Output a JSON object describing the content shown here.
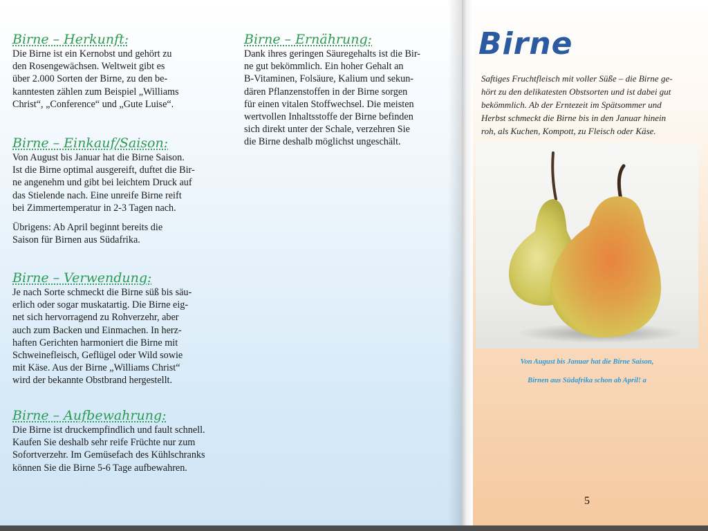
{
  "left": {
    "herkunft": {
      "heading": "Birne – Herkunft:",
      "text": "Die Birne ist ein Kernobst und gehört zu\nden Rosengewächsen. Weltweit gibt es\nüber 2.000 Sorten der Birne, zu den be-\nkanntesten zählen zum Beispiel „Williams\nChrist“, „Conference“ und „Gute Luise“."
    },
    "einkauf": {
      "heading": "Birne – Einkauf/Saison:",
      "text": "Von August bis Januar hat die Birne Saison.\nIst die Birne optimal ausgereift, duftet die Bir-\nne angenehm und gibt bei leichtem Druck auf\ndas Stielende nach. Eine unreife Birne reift\nbei Zimmertemperatur in 2-3 Tagen nach.",
      "text2": "Übrigens: Ab April beginnt bereits die\nSaison für Birnen aus Südafrika."
    },
    "verwendung": {
      "heading": "Birne – Verwendung:",
      "text": "Je nach Sorte schmeckt die Birne süß bis säu-\nerlich oder sogar muskatartig. Die Birne eig-\nnet sich hervorragend zu Rohverzehr, aber\nauch zum Backen und Einmachen. In herz-\nhaften Gerichten harmoniert die Birne mit\nSchweinefleisch, Geflügel oder Wild sowie\nmit Käse. Aus der Birne „Williams Christ“\nwird der bekannte Obstbrand hergestellt."
    },
    "aufbewahrung": {
      "heading": "Birne – Aufbewahrung:",
      "text": "Die Birne ist druckempfindlich und fault schnell.\nKaufen Sie deshalb sehr reife Früchte nur zum\nSofortverzehr. Im Gemüsefach des Kühlschranks\nkönnen Sie die Birne 5-6 Tage aufbewahren."
    },
    "ernaehrung": {
      "heading": "Birne – Ernährung:",
      "text": "Dank ihres geringen Säuregehalts ist die Bir-\nne gut bekömmlich. Ein hoher Gehalt an\nB-Vitaminen, Folsäure, Kalium und sekun-\ndären Pflanzenstoffen in der Birne sorgen\nfür einen vitalen Stoffwechsel. Die meisten\nwertvollen Inhaltsstoffe der Birne befinden\nsich direkt unter der Schale, verzehren Sie\ndie Birne deshalb möglichst ungeschält."
    }
  },
  "right": {
    "title": "Birne",
    "intro": "Saftiges Fruchtfleisch mit voller Süße – die Birne ge-\nhört zu den delikatesten Obstsorten und ist dabei gut\nbekömmlich. Ab der Erntezeit im Spätsommer und\nHerbst schmeckt die Birne bis in den Januar hinein\nroh, als Kuchen, Kompott, zu Fleisch oder Käse.",
    "caption_line1": "Von August bis Januar hat die Birne Saison,",
    "caption_line2": "Birnen aus Südafrika schon ab April! a",
    "page_number": "5"
  },
  "colors": {
    "heading": "#2b9a52",
    "title": "#2c5aa0",
    "caption": "#2d9ad6"
  }
}
